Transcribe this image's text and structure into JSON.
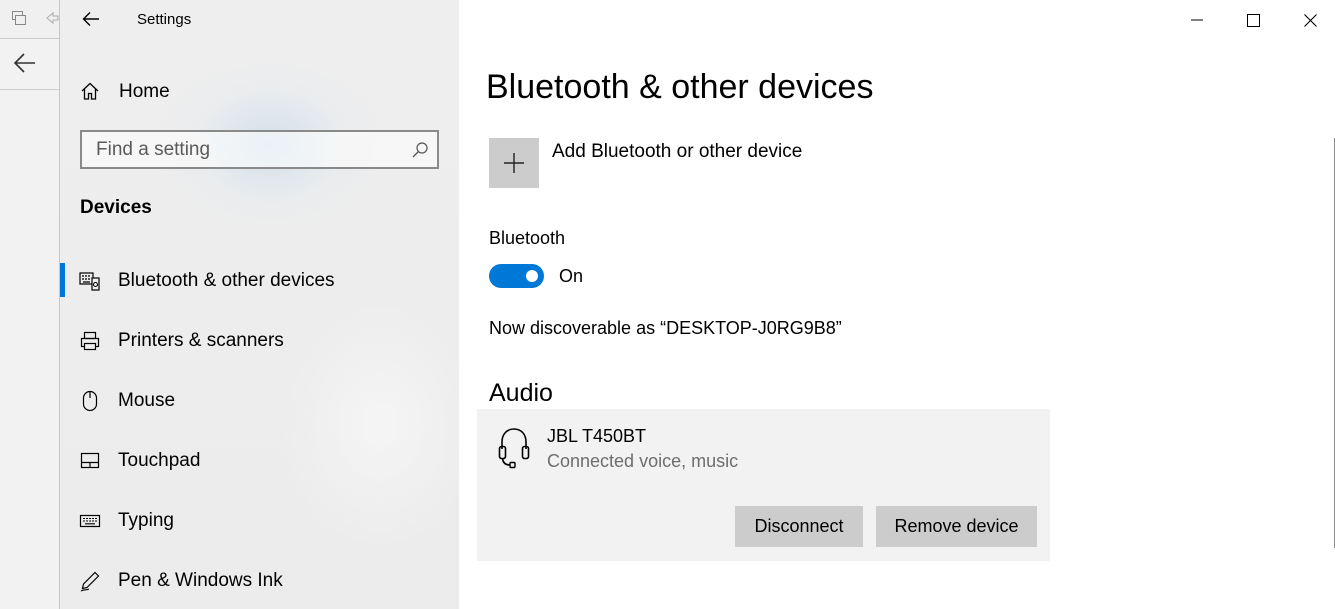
{
  "window": {
    "title": "Settings",
    "controls": [
      "minimize",
      "maximize",
      "close"
    ]
  },
  "nav": {
    "home_label": "Home",
    "search": {
      "placeholder": "Find a setting"
    },
    "section_header": "Devices",
    "items": [
      {
        "label": "Bluetooth & other devices",
        "icon": "bluetooth-devices-icon",
        "selected": true
      },
      {
        "label": "Printers & scanners",
        "icon": "printer-icon",
        "selected": false
      },
      {
        "label": "Mouse",
        "icon": "mouse-icon",
        "selected": false
      },
      {
        "label": "Touchpad",
        "icon": "touchpad-icon",
        "selected": false
      },
      {
        "label": "Typing",
        "icon": "keyboard-icon",
        "selected": false
      },
      {
        "label": "Pen & Windows Ink",
        "icon": "pen-icon",
        "selected": false
      }
    ]
  },
  "main": {
    "page_title": "Bluetooth & other devices",
    "add_device_label": "Add Bluetooth or other device",
    "bluetooth": {
      "label": "Bluetooth",
      "state_label": "On",
      "enabled": true,
      "discoverable_text": "Now discoverable as “DESKTOP-J0RG9B8”"
    },
    "audio": {
      "header": "Audio",
      "devices": [
        {
          "name": "JBL T450BT",
          "status": "Connected voice, music",
          "icon": "headphones-icon",
          "disconnect_label": "Disconnect",
          "remove_label": "Remove device"
        }
      ]
    }
  },
  "colors": {
    "accent": "#0078d7",
    "nav_background": "#ececec",
    "tile_gray": "#cccccc",
    "card_background": "#f2f2f2",
    "secondary_text": "#6d6d6d"
  }
}
